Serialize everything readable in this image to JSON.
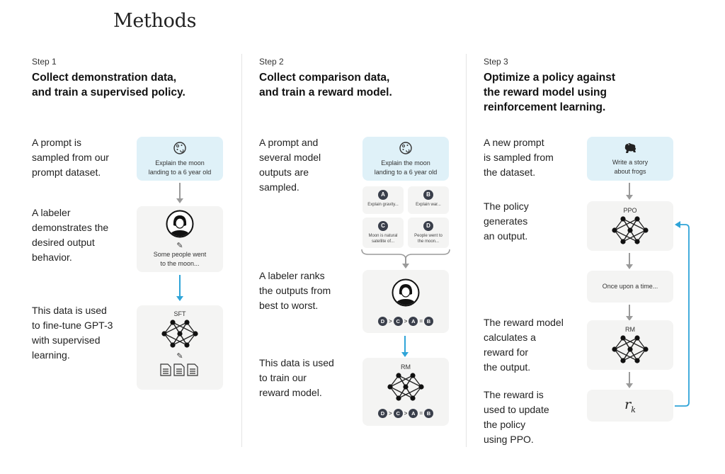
{
  "title": "Methods",
  "steps": [
    {
      "label": "Step 1",
      "heading_lines": [
        "Collect demonstration data,",
        "and train a supervised policy."
      ],
      "descriptions": [
        [
          "A prompt is",
          "sampled from our",
          "prompt dataset."
        ],
        [
          "A labeler",
          "demonstrates the",
          "desired output",
          "behavior."
        ],
        [
          "This data is used",
          "to fine-tune GPT-3",
          "with supervised",
          "learning."
        ]
      ],
      "prompt_card": {
        "icon": "moon-icon",
        "lines": [
          "Explain the moon",
          "landing to a 6 year old"
        ]
      },
      "labeler_card": {
        "icon": "labeler-avatar-icon",
        "edit_icon": "pencil-icon",
        "lines": [
          "Some people went",
          "to the moon..."
        ]
      },
      "model_card": {
        "label": "SFT",
        "icon": "neural-network-icon",
        "edit_icon": "pencil-icon",
        "docs_icon": "documents-icon"
      }
    },
    {
      "label": "Step 2",
      "heading_lines": [
        "Collect comparison data,",
        "and train a reward model."
      ],
      "descriptions": [
        [
          "A prompt and",
          "several model",
          "outputs are",
          "sampled."
        ],
        [
          "A labeler ranks",
          "the outputs from",
          "best to worst."
        ],
        [
          "This data is used",
          "to train our",
          "reward model."
        ]
      ],
      "prompt_card": {
        "icon": "moon-icon",
        "lines": [
          "Explain the moon",
          "landing to a 6 year old"
        ]
      },
      "outputs": [
        {
          "letter": "A",
          "lines": [
            "Explain gravity..."
          ]
        },
        {
          "letter": "B",
          "lines": [
            "Explain war..."
          ]
        },
        {
          "letter": "C",
          "lines": [
            "Moon is natural",
            "satellite of..."
          ]
        },
        {
          "letter": "D",
          "lines": [
            "People went to",
            "the moon..."
          ]
        }
      ],
      "ranking": [
        "D",
        ">",
        "C",
        ">",
        "A",
        "=",
        "B"
      ],
      "model_card": {
        "label": "RM",
        "icon": "neural-network-icon"
      }
    },
    {
      "label": "Step 3",
      "heading_lines": [
        "Optimize a policy against",
        "the reward model using",
        "reinforcement learning."
      ],
      "descriptions": [
        [
          "A new prompt",
          "is sampled from",
          "the dataset."
        ],
        [
          "The policy",
          "generates",
          "an output."
        ],
        [
          "The reward model",
          "calculates a",
          "reward for",
          "the output."
        ],
        [
          "The reward is",
          "used to update",
          "the policy",
          "using PPO."
        ]
      ],
      "prompt_card": {
        "icon": "frog-icon",
        "lines": [
          "Write a story",
          "about frogs"
        ]
      },
      "policy_card": {
        "label": "PPO",
        "icon": "neural-network-icon"
      },
      "output_card": {
        "text": "Once upon a time..."
      },
      "rm_card": {
        "label": "RM",
        "icon": "neural-network-icon"
      },
      "reward_card": {
        "symbol": "r",
        "subscript": "k"
      }
    }
  ],
  "colors": {
    "prompt_bg": "#dff1f8",
    "card_bg": "#f4f4f3",
    "arrow_gray": "#9a9a9a",
    "arrow_blue": "#2fa4d8",
    "badge": "#3a3f4b"
  }
}
